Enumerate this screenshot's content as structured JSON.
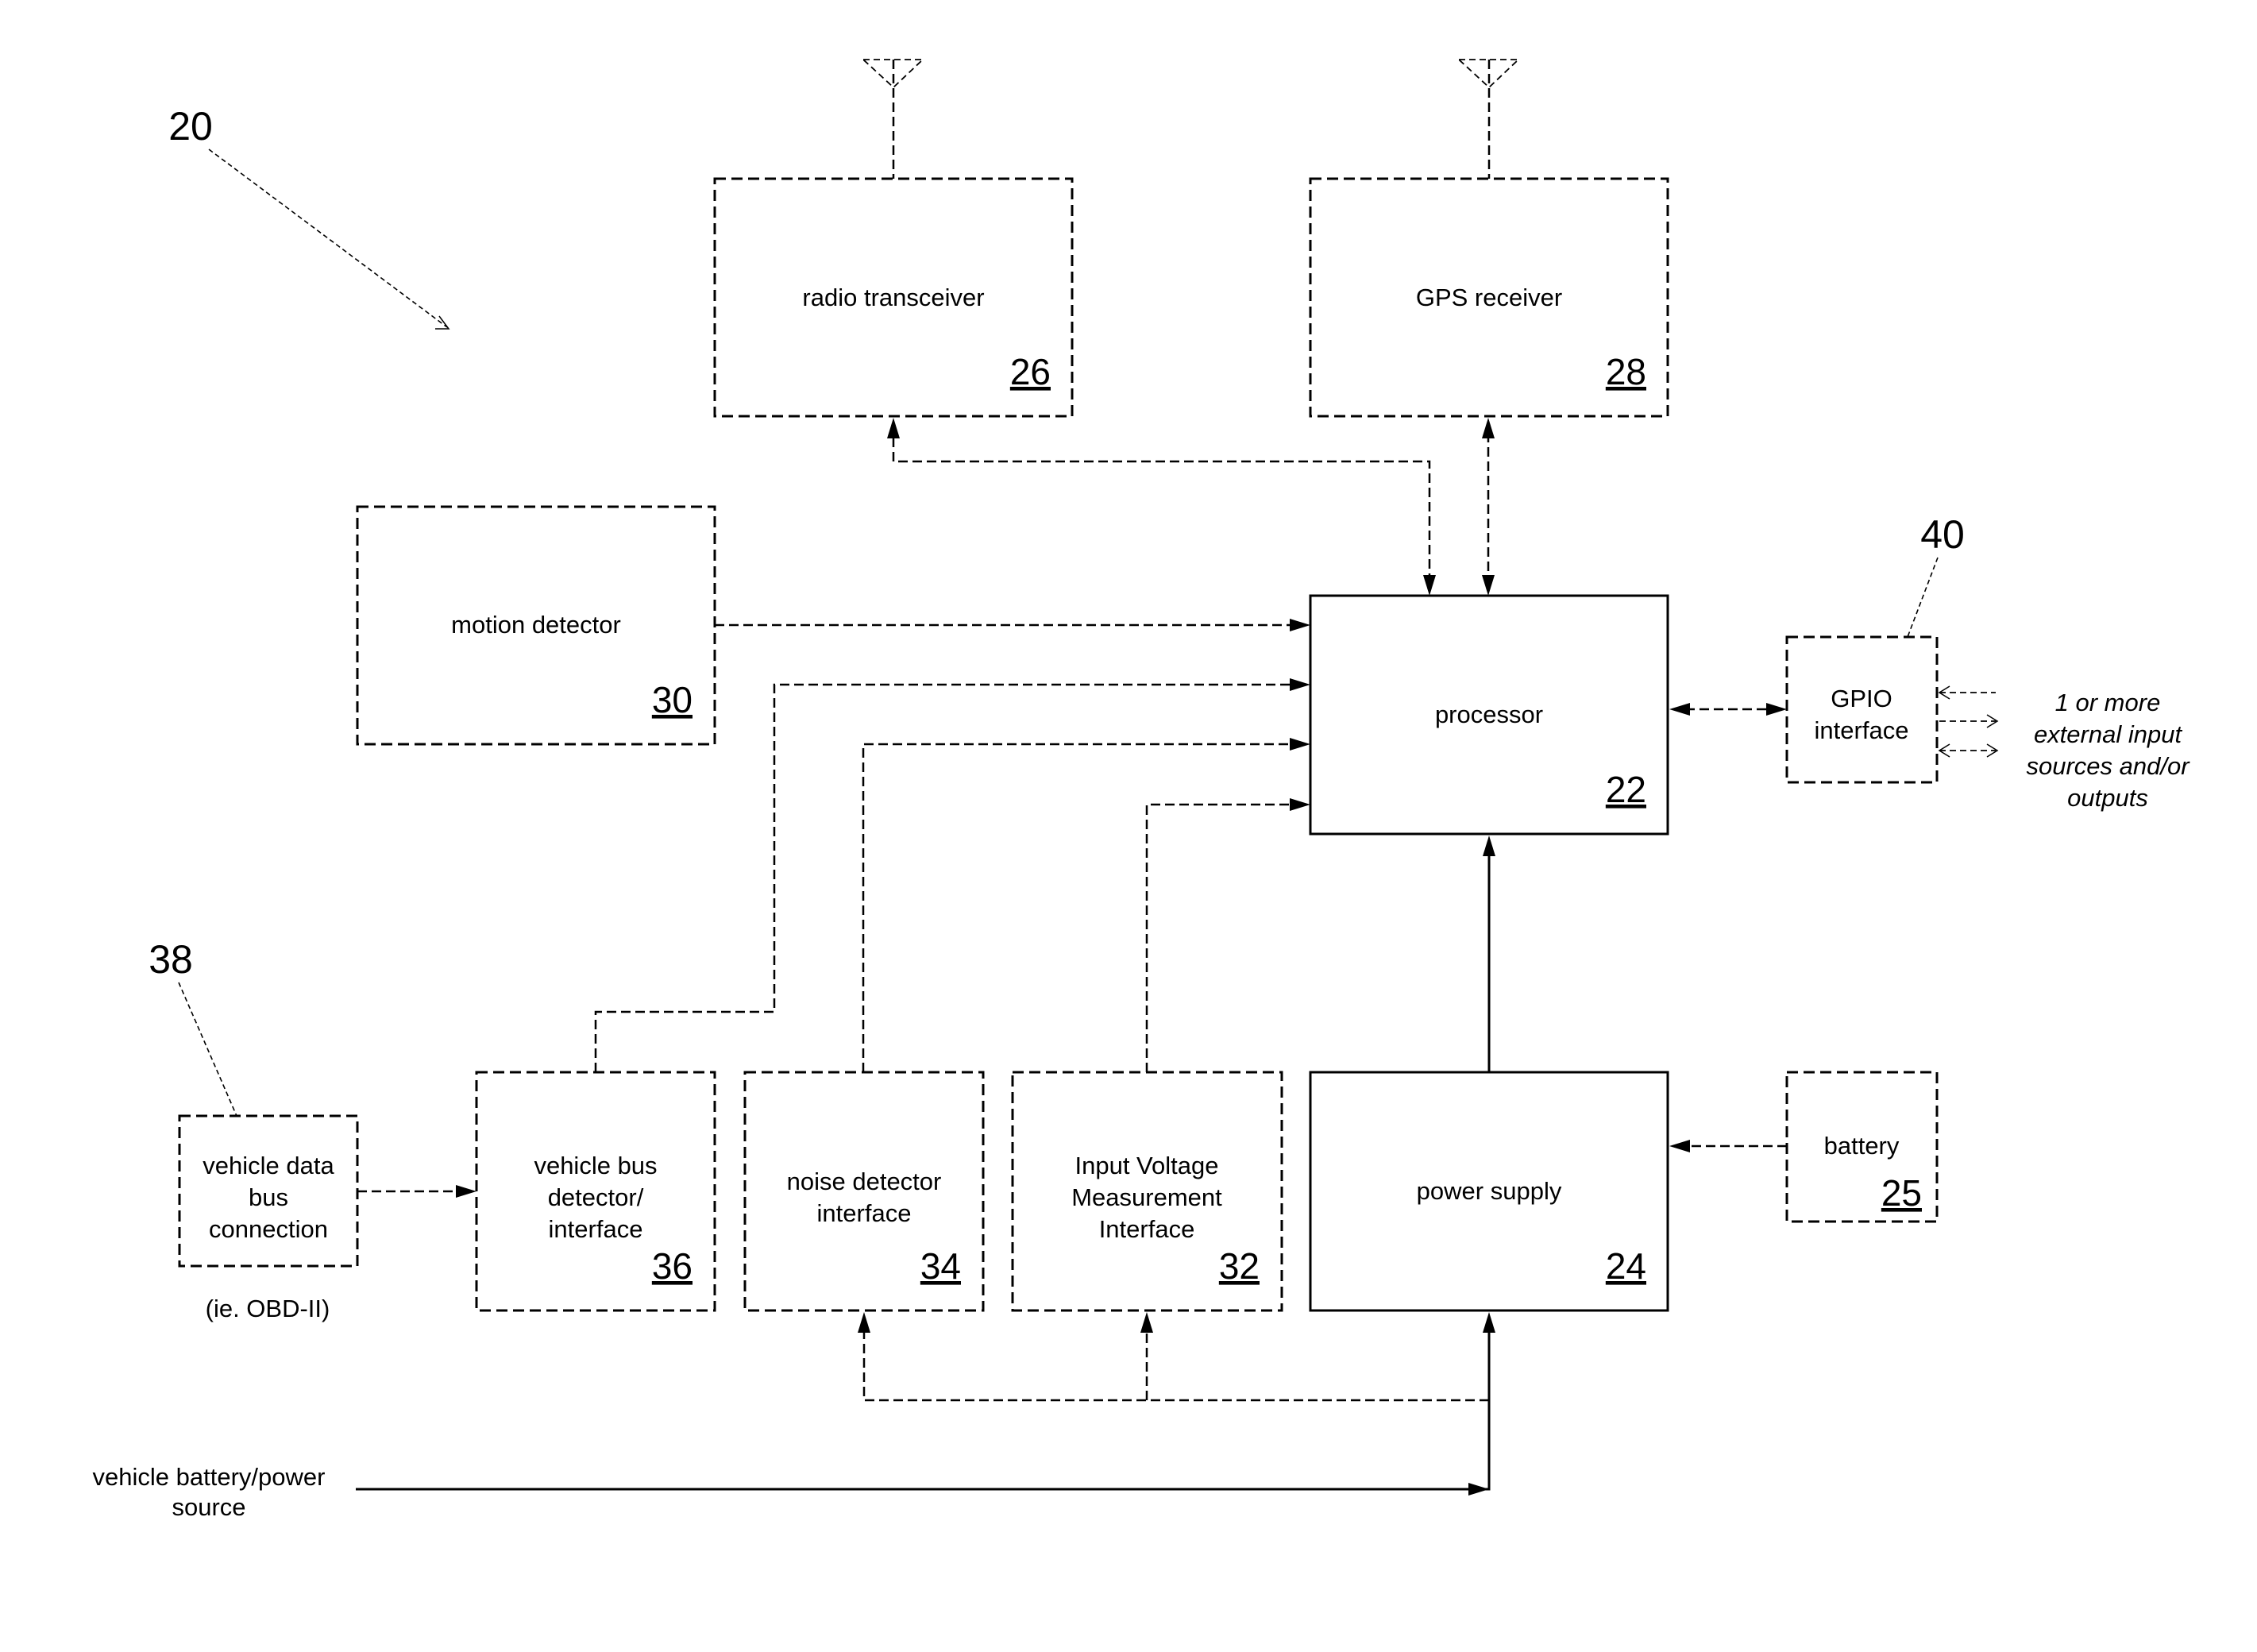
{
  "figure_ref": "20",
  "blocks": {
    "radio": {
      "label": "radio transceiver",
      "ref": "26"
    },
    "gps": {
      "label": "GPS receiver",
      "ref": "28"
    },
    "motion": {
      "label": "motion detector",
      "ref": "30"
    },
    "processor": {
      "label": "processor",
      "ref": "22"
    },
    "gpio": {
      "lines": [
        "GPIO",
        "interface"
      ],
      "callout": "40"
    },
    "data_bus": {
      "lines": [
        "vehicle data",
        "bus",
        "connection"
      ],
      "callout": "38",
      "note": "(ie. OBD-II)"
    },
    "bus_detector": {
      "lines": [
        "vehicle bus",
        "detector/",
        "interface"
      ],
      "ref": "36"
    },
    "noise": {
      "lines": [
        "noise detector",
        "interface"
      ],
      "ref": "34"
    },
    "input_voltage": {
      "lines": [
        "Input Voltage",
        "Measurement",
        "Interface"
      ],
      "ref": "32"
    },
    "power_supply": {
      "label": "power supply",
      "ref": "24"
    },
    "battery": {
      "label": "battery",
      "ref": "25"
    }
  },
  "external_io": {
    "lines": [
      "1 or more",
      "external input",
      "sources and/or",
      "outputs"
    ]
  },
  "power_source": {
    "lines": [
      "vehicle battery/power",
      "source"
    ]
  }
}
